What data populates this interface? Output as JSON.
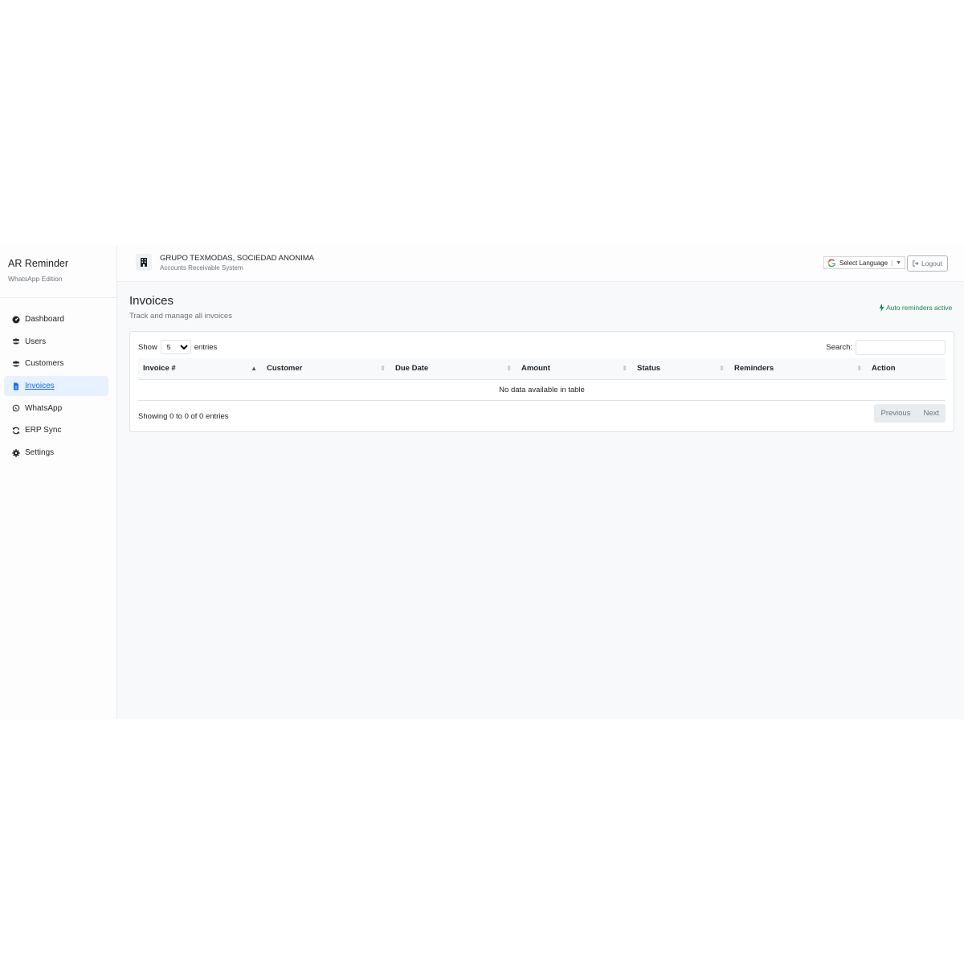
{
  "brand": {
    "title": "AR Reminder",
    "subtitle": "WhatsApp Edition"
  },
  "sidebar": {
    "items": [
      {
        "label": "Dashboard",
        "icon": "gauge-icon"
      },
      {
        "label": "Users",
        "icon": "users-icon"
      },
      {
        "label": "Customers",
        "icon": "users-icon"
      },
      {
        "label": "Invoices",
        "icon": "file-icon",
        "active": true
      },
      {
        "label": "WhatsApp",
        "icon": "whatsapp-icon"
      },
      {
        "label": "ERP Sync",
        "icon": "sync-icon"
      },
      {
        "label": "Settings",
        "icon": "gear-icon"
      }
    ]
  },
  "header": {
    "company": "GRUPO TEXMODAS, SOCIEDAD ANONIMA",
    "subtitle": "Accounts Receivable System",
    "language": "Select Language",
    "logout": "Logout"
  },
  "page": {
    "title": "Invoices",
    "subtitle": "Track and manage all invoices",
    "auto_status": "Auto reminders active"
  },
  "table": {
    "show_label": "Show",
    "entries_label": "entries",
    "page_size": "5",
    "search_label": "Search:",
    "columns": [
      "Invoice #",
      "Customer",
      "Due Date",
      "Amount",
      "Status",
      "Reminders",
      "Action"
    ],
    "empty_message": "No data available in table",
    "info": "Showing 0 to 0 of 0 entries",
    "prev": "Previous",
    "next": "Next"
  },
  "colors": {
    "accent": "#0d6efd",
    "success": "#198754",
    "active_bg": "#e7f1ff"
  }
}
